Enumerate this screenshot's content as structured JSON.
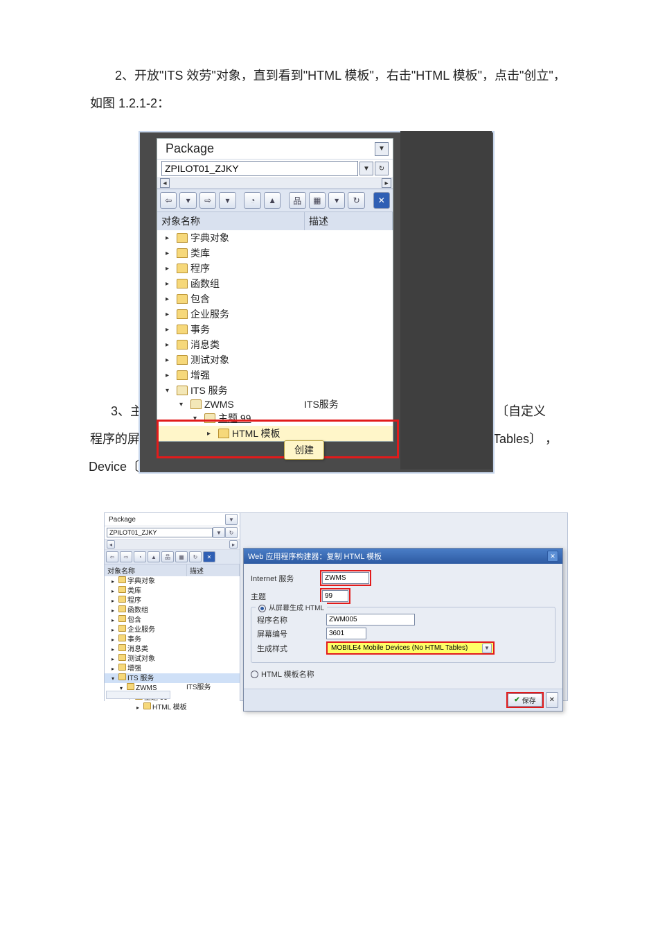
{
  "para1": "2、开放\"ITS 效劳\"对象，直到看到\"HTML 模板\"，右击\"HTML 模板\"，点击\"创立\"，如图 1.2.1-2：",
  "behind_left": "3、主",
  "behind_mid": "程序的屏",
  "behind_dev": "Device〔",
  "behind_right1": "〔自定义",
  "behind_right2": "Tables〕 ，",
  "sap1": {
    "package_label": "Package",
    "package_value": "ZPILOT01_ZJKY",
    "col_name": "对象名称",
    "col_desc": "描述",
    "tree": [
      "字典对象",
      "类库",
      "程序",
      "函数组",
      "包含",
      "企业服务",
      "事务",
      "消息类",
      "测试对象",
      "增强"
    ],
    "its_label": "ITS 服务",
    "zwms": "ZWMS",
    "zwms_desc": "ITS服务",
    "topic99": "主题 99",
    "html_tpl": "HTML 模板",
    "tooltip": "创建"
  },
  "sap2": {
    "package_label": "Package",
    "package_value": "ZPILOT01_ZJKY",
    "col_name": "对象名称",
    "col_desc": "描述",
    "tree": [
      "字典对象",
      "类库",
      "程序",
      "函数组",
      "包含",
      "企业服务",
      "事务",
      "消息类",
      "测试对象",
      "增强"
    ],
    "its_label": "ITS 服务",
    "zwms": "ZWMS",
    "zwms_desc": "ITS服务",
    "topic99": "主题 99",
    "html_tpl": "HTML 模板"
  },
  "dialog": {
    "title": "Web 应用程序构建器：复制 HTML 模板",
    "lab_internet": "Internet 服务",
    "val_internet": "ZWMS",
    "lab_topic": "主题",
    "val_topic": "99",
    "group_legend": "从屏幕生成 HTML",
    "lab_prog": "程序名称",
    "val_prog": "ZWM005",
    "lab_screen": "屏幕编号",
    "val_screen": "3601",
    "lab_style": "生成样式",
    "val_style": "MOBILE4 Mobile Devices (No HTML Tables)",
    "radio_html_name": "HTML 模板名称",
    "btn_save": "保存"
  }
}
